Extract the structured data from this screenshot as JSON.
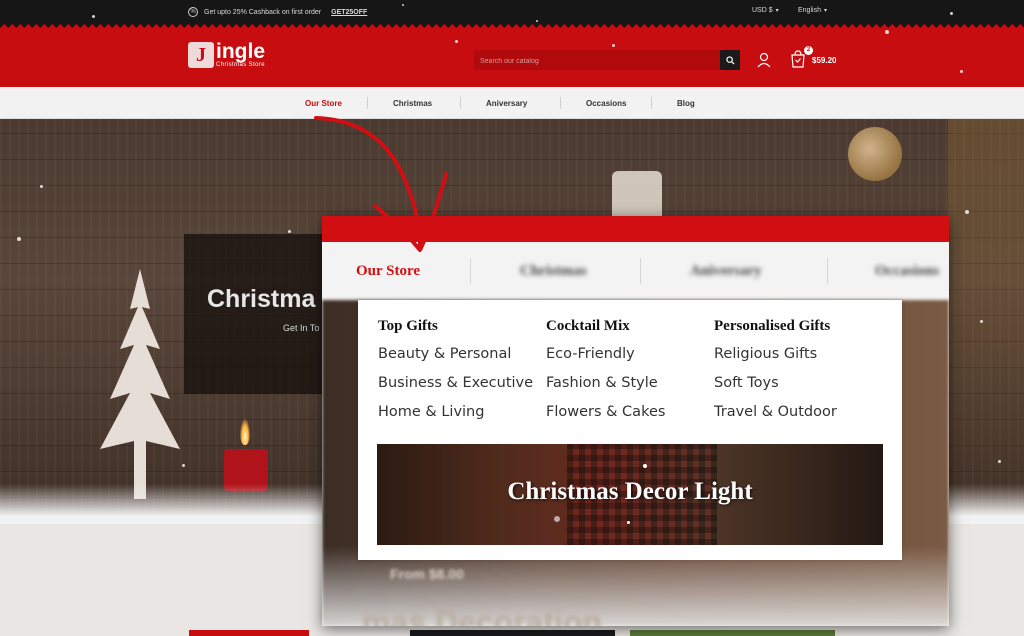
{
  "topbar": {
    "promo_icon": "percent-icon",
    "promo_text": "Get upto 25% Cashback on first order",
    "promo_code": "GET25OFF",
    "currency": "USD $",
    "language": "English"
  },
  "header": {
    "logo_letter": "J",
    "logo_name": "ingle",
    "logo_tagline": "Christmas Store",
    "search_placeholder": "Search our catalog",
    "cart_count": "2",
    "cart_total": "$59.20"
  },
  "nav": {
    "items": [
      {
        "label": "Our Store"
      },
      {
        "label": "Christmas"
      },
      {
        "label": "Aniversary"
      },
      {
        "label": "Occasions"
      },
      {
        "label": "Blog"
      }
    ]
  },
  "hero": {
    "title": "Christma",
    "subtitle": "Get In To"
  },
  "popup": {
    "nav": [
      {
        "label": "Our Store"
      },
      {
        "label": "Christmas"
      },
      {
        "label": "Aniversary"
      },
      {
        "label": "Occasions"
      }
    ],
    "from_text": "From $8.00",
    "bottom_text": "mas Decoration"
  },
  "mega_menu": {
    "columns": [
      {
        "heading": "Top Gifts",
        "links": [
          "Beauty & Personal",
          "Business & Executive",
          "Home & Living"
        ]
      },
      {
        "heading": "Cocktail Mix",
        "links": [
          "Eco-Friendly",
          "Fashion & Style",
          "Flowers & Cakes"
        ]
      },
      {
        "heading": "Personalised Gifts",
        "links": [
          "Religious Gifts",
          "Soft Toys",
          "Travel & Outdoor"
        ]
      }
    ],
    "banner_title": "Christmas Decor Light"
  },
  "colors": {
    "brand_red": "#c80d10",
    "topbar_black": "#161616",
    "nav_bg": "#f2f2f2"
  }
}
